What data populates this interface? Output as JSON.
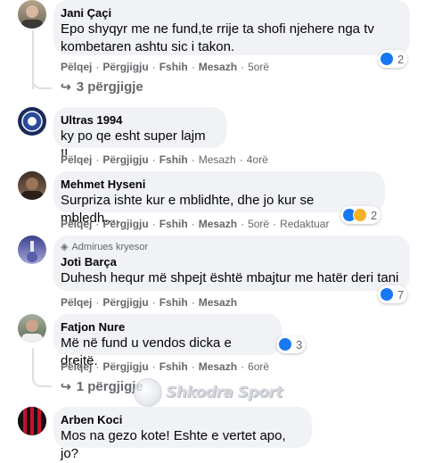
{
  "comments": [
    {
      "author": "Jani Çaçi",
      "text_line1": "Epo shyqyr me ne fund,te rrije ta shofi njehere nga tv",
      "text_line2": "kombetaren ashtu sic i takon.",
      "time": "5orë",
      "reaction_count": "2",
      "replies": "3 përgjigje"
    },
    {
      "author": "Ultras 1994",
      "text": "ky po qe esht super lajm !!",
      "time": "4orë"
    },
    {
      "author": "Mehmet Hyseni",
      "text": "Surpriza ishte kur e mblidhte, dhe jo kur se mbledh....",
      "time": "5orë",
      "edited": "Redaktuar",
      "reaction_count": "2"
    },
    {
      "badge": "Admirues kryesor",
      "author": "Joti Barça",
      "text": "Duhesh hequr më shpejt është mbajtur me hatër deri tani",
      "time": "",
      "reaction_count": "7"
    },
    {
      "author": "Fatjon Nure",
      "text": "Më në fund u vendos dicka e drejtë.",
      "time": "6orë",
      "reaction_count": "3",
      "replies": "1 përgjigje"
    },
    {
      "author": "Arben Koci",
      "text": "Mos na gezo kote! Eshte e vertet apo, jo?"
    }
  ],
  "actions": {
    "like": "Pëlqej",
    "reply": "Përgjigju",
    "hide": "Fshih",
    "message": "Mesazh"
  },
  "separator": "·",
  "watermark": "Shkodra Sport",
  "colors": {
    "like": "#1877f2",
    "haha": "#f7b125",
    "bubble": "#f0f2f5",
    "meta": "#65676b"
  }
}
